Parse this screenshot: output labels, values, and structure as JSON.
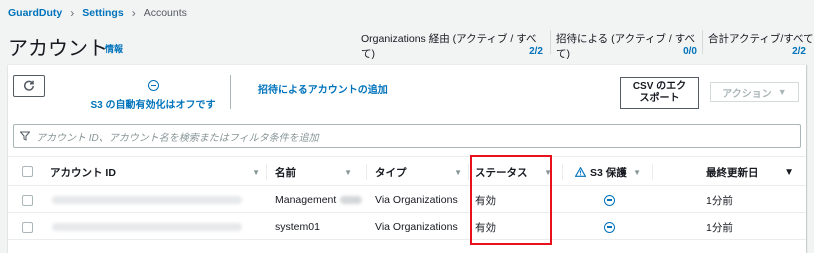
{
  "breadcrumb": {
    "root": "GuardDuty",
    "settings": "Settings",
    "current": "Accounts"
  },
  "page": {
    "title": "アカウント",
    "info": "情報"
  },
  "summaries": [
    {
      "label": "Organizations 経由 (アクティブ / すべて)",
      "value": "2/2"
    },
    {
      "label": "招待による (アクティブ / すべて)",
      "value": "0/0"
    },
    {
      "label": "合計アクティブ/すべて",
      "value": "2/2"
    }
  ],
  "toolbar": {
    "s3_auto_enable": "S3 の自動有効化はオフです",
    "invite_link": "招待によるアカウントの追加",
    "csv_export": "CSV のエクスポート",
    "csv_line1": "CSV のエク",
    "csv_line2": "スポート",
    "actions": "アクション"
  },
  "search": {
    "placeholder": "アカウント ID、アカウント名を検索またはフィルタ条件を追加"
  },
  "table": {
    "headers": {
      "account_id": "アカウント ID",
      "name": "名前",
      "type": "タイプ",
      "status": "ステータス",
      "s3": "S3 保護",
      "updated": "最終更新日"
    },
    "rows": [
      {
        "account_id": "",
        "name": "Management",
        "type": "Via Organizations",
        "status": "有効",
        "s3": "minus-circle-icon",
        "updated": "1分前"
      },
      {
        "account_id": "",
        "name": "system01",
        "type": "Via Organizations",
        "status": "有効",
        "s3": "minus-circle-icon",
        "updated": "1分前"
      }
    ]
  },
  "colors": {
    "link": "#0073bb",
    "highlight": "#e8101c",
    "warning": "#0073bb"
  }
}
